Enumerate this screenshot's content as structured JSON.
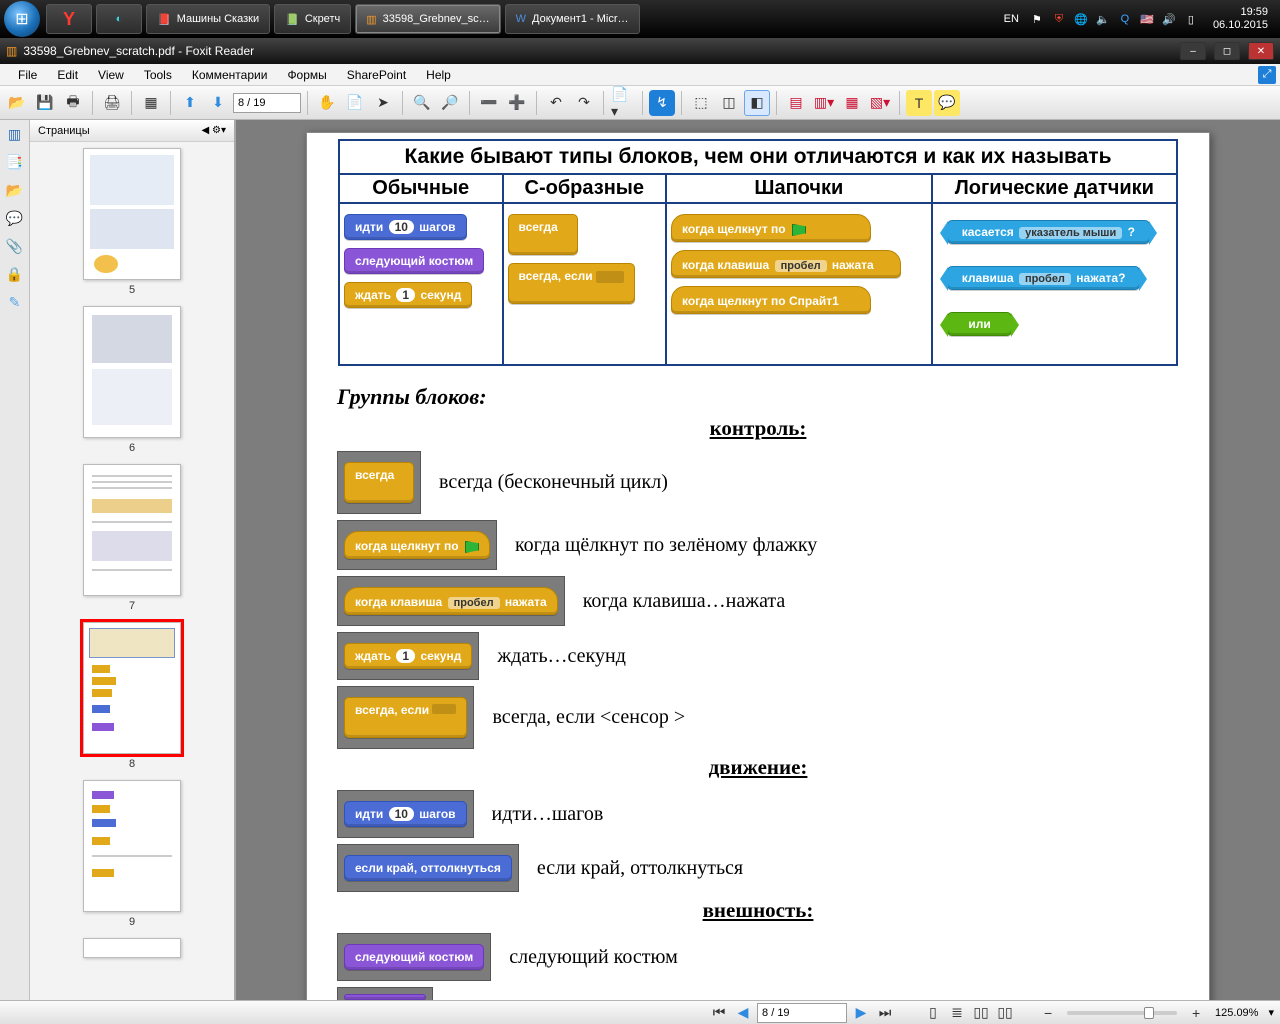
{
  "taskbar": {
    "apps": [
      {
        "label": "Машины Сказки"
      },
      {
        "label": "Скретч"
      },
      {
        "label": "33598_Grebnev_sc…",
        "active": true
      },
      {
        "label": "Документ1 - Micr…"
      }
    ],
    "lang": "EN",
    "time": "19:59",
    "date": "06.10.2015"
  },
  "window": {
    "title": "33598_Grebnev_scratch.pdf - Foxit Reader"
  },
  "menu": {
    "items": [
      "File",
      "Edit",
      "View",
      "Tools",
      "Комментарии",
      "Формы",
      "SharePoint",
      "Help"
    ]
  },
  "toolbar": {
    "page_label": "8 / 19"
  },
  "sidebar": {
    "title": "Страницы",
    "thumbs": [
      {
        "n": "5"
      },
      {
        "n": "6"
      },
      {
        "n": "7"
      },
      {
        "n": "8",
        "current": true
      },
      {
        "n": "9"
      }
    ]
  },
  "doc": {
    "table_title": "Какие бывают типы блоков, чем они отличаются и как их называть",
    "cols": [
      "Обычные",
      "С-образные",
      "Шапочки",
      "Логические датчики"
    ],
    "usual": {
      "b1_pre": "идти",
      "b1_pill": "10",
      "b1_post": "шагов",
      "b2": "следующий костюм",
      "b3_pre": "ждать",
      "b3_pill": "1",
      "b3_post": "секунд"
    },
    "cshape": {
      "b1": "всегда",
      "b2": "всегда, если"
    },
    "hats": {
      "b1": "когда щелкнут по",
      "b2_pre": "когда клавиша",
      "b2_drop": "пробел",
      "b2_post": "нажата",
      "b3": "когда щелкнут по  Спрайт1"
    },
    "sensors": {
      "b1_pre": "касается",
      "b1_drop": "указатель мыши",
      "b1_post": "?",
      "b2_pre": "клавиша",
      "b2_drop": "пробел",
      "b2_post": "нажата?",
      "b3": "или"
    },
    "groups_heading": "Группы блоков:",
    "control": {
      "head": "контроль:",
      "r1_blk": "всегда",
      "r1_txt": "всегда (бесконечный цикл)",
      "r2_blk": "когда щелкнут по",
      "r2_txt": "когда щёлкнут по зелёному флажку",
      "r3_pre": "когда клавиша",
      "r3_drop": "пробел",
      "r3_post": "нажата",
      "r3_txt": "когда клавиша…нажата",
      "r4_pre": "ждать",
      "r4_pill": "1",
      "r4_post": "секунд",
      "r4_txt": "ждать…секунд",
      "r5_blk": "всегда, если",
      "r5_txt": "всегда, если <сенсор >"
    },
    "motion": {
      "head": "движение:",
      "r1_pre": "идти",
      "r1_pill": "10",
      "r1_post": "шагов",
      "r1_txt": "идти…шагов",
      "r2_blk": "если край, оттолкнуться",
      "r2_txt": "если край, оттолкнуться"
    },
    "looks": {
      "head": "внешность:",
      "r1_blk": "следующий костюм",
      "r1_txt": "следующий костюм"
    }
  },
  "status": {
    "page_label": "8 / 19",
    "zoom": "125.09%"
  }
}
